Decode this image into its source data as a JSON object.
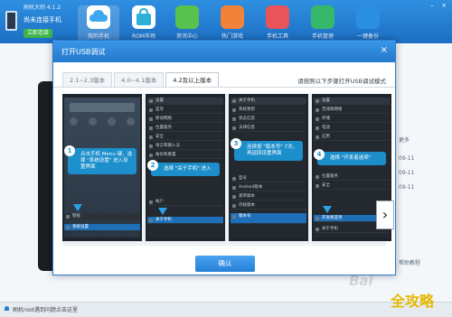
{
  "app": {
    "title": "刷机大师 4.1.2",
    "connect_text": "尚未连接手机",
    "connect_button": "立即连接",
    "nav": [
      {
        "label": "我的手机",
        "icon": "cloud-icon",
        "color": "#3da7f0"
      },
      {
        "label": "ROM市场",
        "icon": "shopping-bag-icon",
        "color": "#2fb0d8"
      },
      {
        "label": "资讯中心",
        "icon": "news-icon",
        "color": "#59c24f"
      },
      {
        "label": "热门游戏",
        "icon": "gamepad-icon",
        "color": "#f0823a"
      },
      {
        "label": "手机工具",
        "icon": "toolbox-icon",
        "color": "#e8545a"
      },
      {
        "label": "手机管理",
        "icon": "shield-icon",
        "color": "#36b86a"
      },
      {
        "label": "一键备份",
        "icon": "backup-icon",
        "color": "#2a8fe0"
      }
    ],
    "side_more": "更多",
    "side_dates": [
      "09-11",
      "09-11",
      "09-11"
    ],
    "side_link": "帮助教程",
    "status_text": "刷机root遇到问题点击这里",
    "watermark_text": "Bai",
    "watermark2": "全攻略"
  },
  "modal": {
    "title": "打开USB调试",
    "close": "×",
    "tabs": [
      {
        "label": "2.1~2.3版本",
        "active": false
      },
      {
        "label": "4.0~4.1版本",
        "active": false
      },
      {
        "label": "4.2及以上版本",
        "active": true
      }
    ],
    "instruction": "请按照以下步骤打开USB调试模式",
    "steps": [
      {
        "num": "1",
        "text": "点击手机 Menu 键，选择 \"系统设置\" 进入设置界面"
      },
      {
        "num": "2",
        "text": "选择 \"关于手机\" 进入"
      },
      {
        "num": "3",
        "text": "连续按 \"版本号\" 7次，再返回设置界面"
      },
      {
        "num": "4",
        "text": "选择 \"开发者选项\""
      }
    ],
    "screen_rows": {
      "s1": [
        "壁纸",
        "系统设置"
      ],
      "s2": [
        "设置",
        "蓝牙",
        "移动网络",
        "位置服务",
        "安全",
        "语言和输入法",
        "备份和重置",
        "帐户",
        "关于手机"
      ],
      "s3": [
        "关于手机",
        "系统更新",
        "状态信息",
        "法律信息",
        "型号",
        "Android版本",
        "基带版本",
        "内核版本",
        "版本号"
      ],
      "s4": [
        "设置",
        "无线和网络",
        "存储",
        "电池",
        "应用",
        "位置服务",
        "安全",
        "开发者选项",
        "关于手机"
      ]
    },
    "next": "›",
    "confirm": "确认"
  }
}
